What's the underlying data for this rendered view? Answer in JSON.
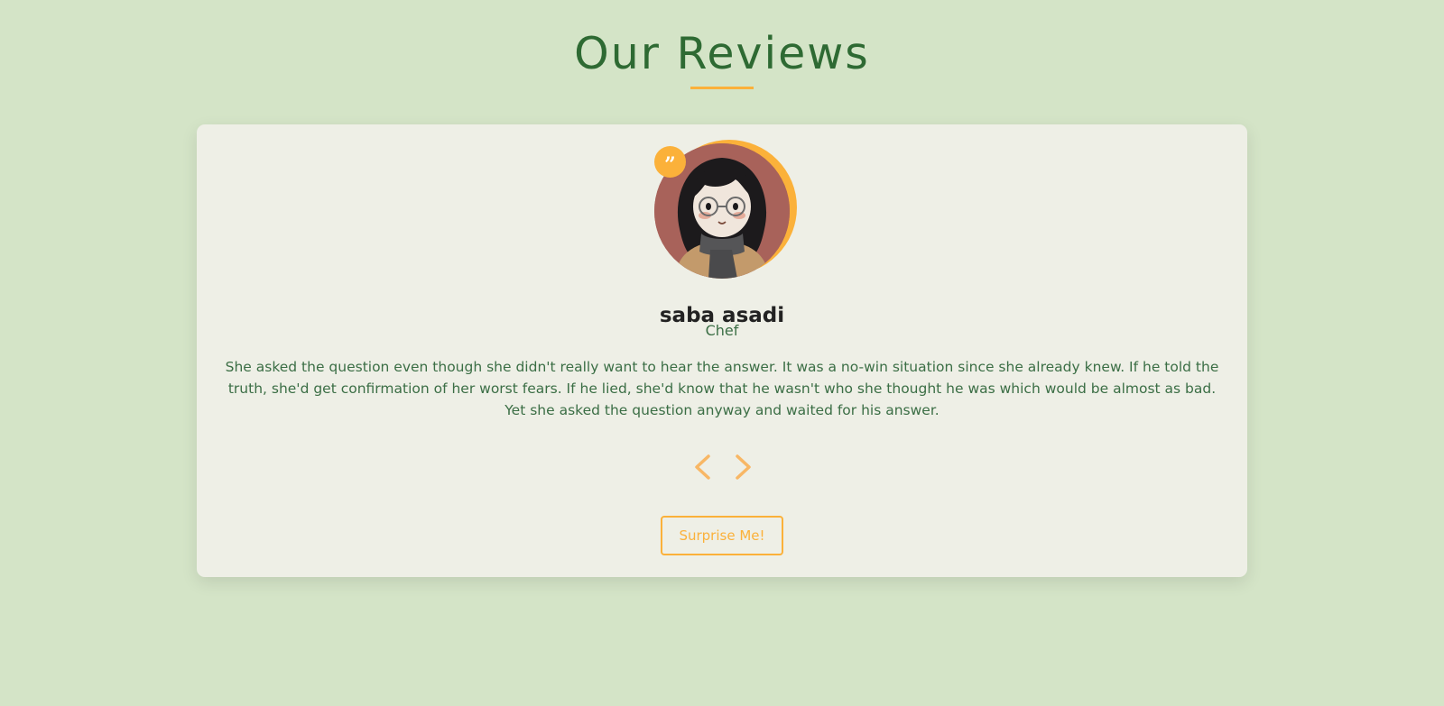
{
  "header": {
    "title": "Our Reviews"
  },
  "review": {
    "name": "saba asadi",
    "job": "Chef",
    "text": "She asked the question even though she didn't really want to hear the answer. It was a no-win situation since she already knew. If he told the truth, she'd get confirmation of her worst fears. If he lied, she'd know that he wasn't who she thought he was which would be almost as bad. Yet she asked the question anyway and waited for his answer.",
    "quote_icon": "quote-icon",
    "avatar_icon": "avatar-illustration"
  },
  "controls": {
    "prev_icon": "chevron-left-icon",
    "next_icon": "chevron-right-icon",
    "surprise_label": "Surprise Me!"
  },
  "colors": {
    "background": "#d4e4c7",
    "card": "#eeefe6",
    "accent": "#fbb13a",
    "heading": "#2e6a33",
    "text": "#3b6e45"
  }
}
